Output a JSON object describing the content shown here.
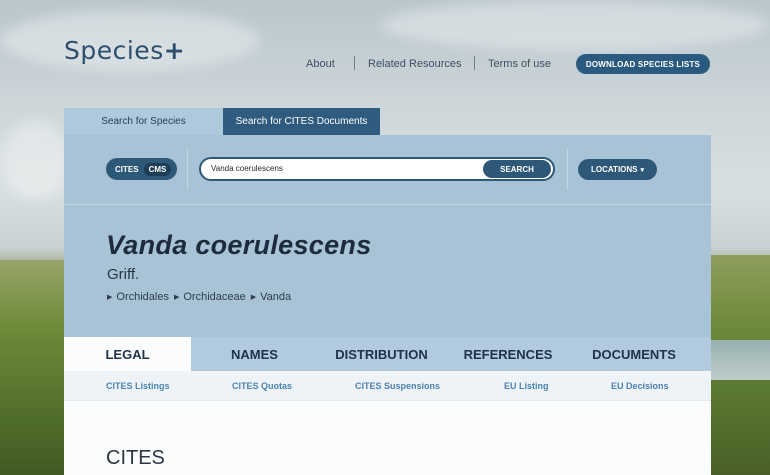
{
  "header": {
    "logo_text": "Species",
    "logo_plus": "+",
    "nav": {
      "about": "About",
      "related_resources": "Related Resources",
      "terms": "Terms of use"
    },
    "download_label": "DOWNLOAD SPECIES LISTS"
  },
  "search_tabs": {
    "species": "Search for Species",
    "cites_documents": "Search for CITES Documents"
  },
  "search": {
    "toggle_cites": "CITES",
    "toggle_cms": "CMS",
    "query": "Vanda coerulescens",
    "button": "SEARCH",
    "locations": "LOCATIONS",
    "locations_caret": "▾"
  },
  "species": {
    "name": "Vanda coerulescens",
    "author": "Griff.",
    "taxonomy": [
      "Orchidales",
      "Orchidaceae",
      "Vanda"
    ]
  },
  "main_tabs": {
    "legal": "LEGAL",
    "names": "NAMES",
    "distribution": "DISTRIBUTION",
    "references": "REFERENCES",
    "documents": "DOCUMENTS"
  },
  "subnav": {
    "cites_listings": "CITES Listings",
    "cites_quotas": "CITES Quotas",
    "cites_suspensions": "CITES Suspensions",
    "eu_listing": "EU Listing",
    "eu_decisions": "EU Decisions"
  },
  "section_heading": "CITES",
  "colors": {
    "primary_dark": "#2e5878",
    "panel_blue": "#a8c3d6",
    "link_blue": "#4c82b0"
  }
}
